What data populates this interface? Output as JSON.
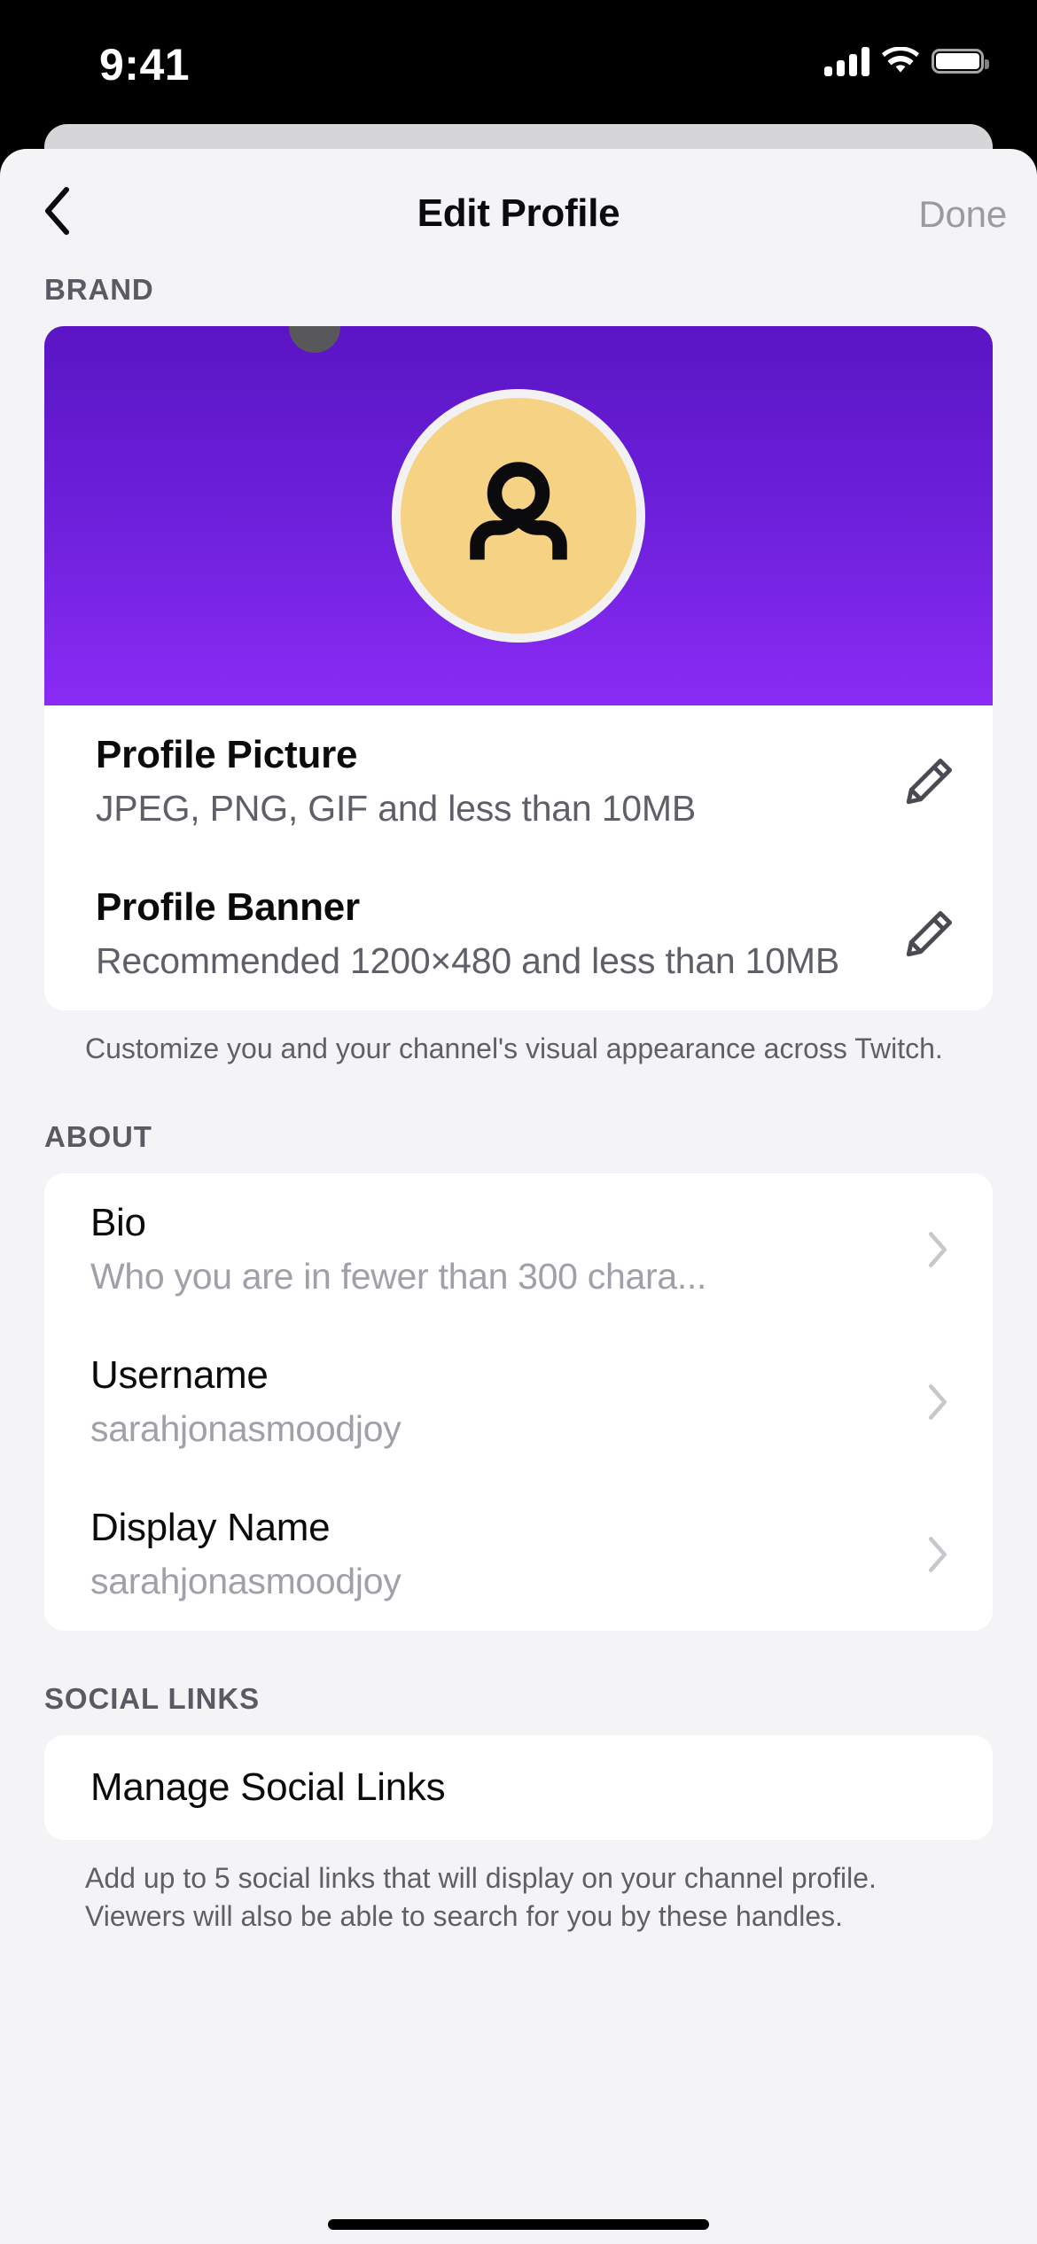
{
  "status_bar": {
    "time": "9:41",
    "cellular_icon": "cellular-signal-icon",
    "wifi_icon": "wifi-icon",
    "battery_icon": "battery-full-icon"
  },
  "navbar": {
    "back_icon": "chevron-left-icon",
    "title": "Edit Profile",
    "done_label": "Done"
  },
  "brand": {
    "section_header": "BRAND",
    "banner": {
      "gradient_from": "#5B15C4",
      "gradient_to": "#8A2BF4",
      "avatar_icon": "person-avatar-icon",
      "avatar_color": "#F6D285",
      "avatar_ring_color": "#F2F2F2",
      "handle_dot": "drag-handle-dot"
    },
    "rows": [
      {
        "title": "Profile Picture",
        "subtitle": "JPEG, PNG, GIF and less than 10MB",
        "action_icon": "pencil-icon"
      },
      {
        "title": "Profile Banner",
        "subtitle": "Recommended 1200×480 and less than 10MB",
        "action_icon": "pencil-icon"
      }
    ],
    "footer": "Customize you and your channel's visual appearance across Twitch."
  },
  "about": {
    "section_header": "ABOUT",
    "rows": [
      {
        "label": "Bio",
        "value": "Who you are in fewer than 300 chara...",
        "action_icon": "chevron-right-icon"
      },
      {
        "label": "Username",
        "value": "sarahjonasmoodjoy",
        "action_icon": "chevron-right-icon"
      },
      {
        "label": "Display Name",
        "value": "sarahjonasmoodjoy",
        "action_icon": "chevron-right-icon"
      }
    ]
  },
  "social_links": {
    "section_header": "SOCIAL LINKS",
    "manage_label": "Manage Social Links",
    "footer": "Add up to 5 social links that will display on your channel profile. Viewers will also be able to search for you by these handles."
  }
}
